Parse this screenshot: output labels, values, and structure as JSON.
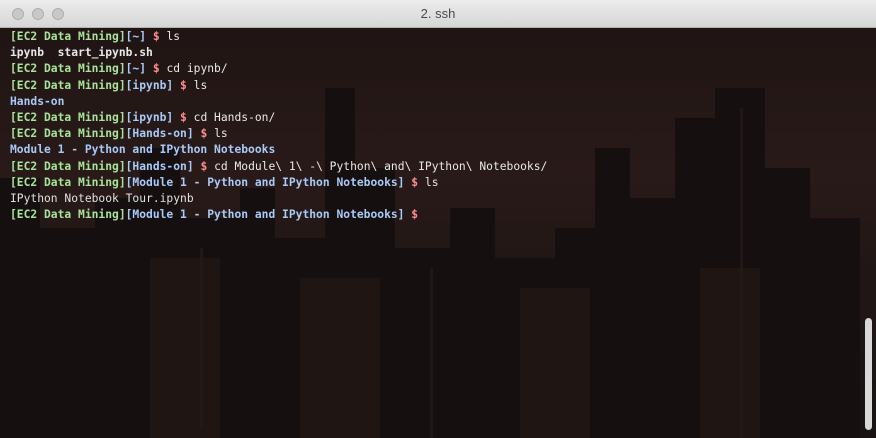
{
  "window": {
    "title": "2. ssh"
  },
  "colors": {
    "prompt_green": "#a8e39a",
    "prompt_blue": "#a9c9f7",
    "dollar": "#ff8c8c",
    "text": "#e8e8e8"
  },
  "prompt_host": "[EC2 Data Mining]",
  "lines": [
    {
      "kind": "prompt",
      "dir": "[~]",
      "cmd": "ls"
    },
    {
      "kind": "out",
      "style": "bold-white",
      "text": "ipynb  start_ipynb.sh"
    },
    {
      "kind": "prompt",
      "dir": "[~]",
      "cmd": "cd ipynb/"
    },
    {
      "kind": "prompt",
      "dir": "[ipynb]",
      "cmd": "ls"
    },
    {
      "kind": "out",
      "style": "bold-blue",
      "text": "Hands-on"
    },
    {
      "kind": "prompt",
      "dir": "[ipynb]",
      "cmd": "cd Hands-on/"
    },
    {
      "kind": "prompt",
      "dir": "[Hands-on]",
      "cmd": "ls"
    },
    {
      "kind": "out",
      "style": "bold-blue",
      "text": "Module 1 - Python and IPython Notebooks"
    },
    {
      "kind": "prompt",
      "dir": "[Hands-on]",
      "cmd": "cd Module\\ 1\\ -\\ Python\\ and\\ IPython\\ Notebooks/"
    },
    {
      "kind": "prompt",
      "dir": "[Module 1 - Python and IPython Notebooks]",
      "cmd": "ls"
    },
    {
      "kind": "out",
      "style": "plain",
      "text": "IPython Notebook Tour.ipynb"
    },
    {
      "kind": "prompt",
      "dir": "[Module 1 - Python and IPython Notebooks]",
      "cmd": ""
    }
  ]
}
